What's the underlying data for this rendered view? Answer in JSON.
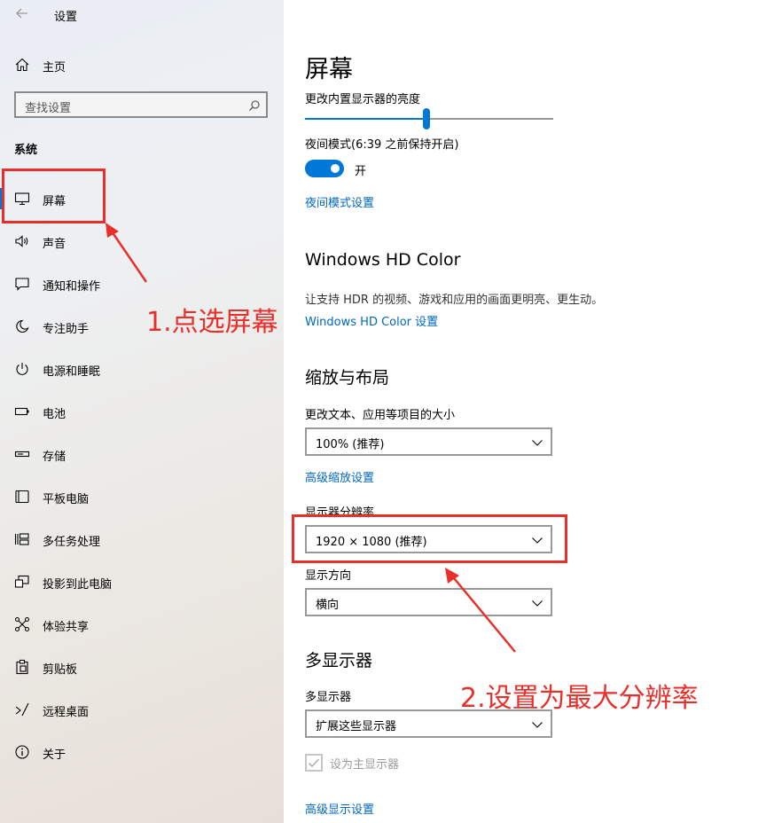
{
  "app": {
    "title": "设置"
  },
  "sidebar": {
    "home_label": "主页",
    "search_placeholder": "查找设置",
    "section_label": "系统",
    "items": [
      {
        "label": "屏幕",
        "icon": "monitor-icon"
      },
      {
        "label": "声音",
        "icon": "speaker-icon"
      },
      {
        "label": "通知和操作",
        "icon": "message-icon"
      },
      {
        "label": "专注助手",
        "icon": "moon-icon"
      },
      {
        "label": "电源和睡眠",
        "icon": "power-icon"
      },
      {
        "label": "电池",
        "icon": "battery-icon"
      },
      {
        "label": "存储",
        "icon": "storage-icon"
      },
      {
        "label": "平板电脑",
        "icon": "tablet-icon"
      },
      {
        "label": "多任务处理",
        "icon": "multitask-icon"
      },
      {
        "label": "投影到此电脑",
        "icon": "project-icon"
      },
      {
        "label": "体验共享",
        "icon": "share-icon"
      },
      {
        "label": "剪贴板",
        "icon": "clipboard-icon"
      },
      {
        "label": "远程桌面",
        "icon": "remote-desktop-icon"
      },
      {
        "label": "关于",
        "icon": "info-icon"
      }
    ]
  },
  "main": {
    "title": "屏幕",
    "brightness_label": "更改内置显示器的亮度",
    "brightness_level": 0.49,
    "night_mode_label": "夜间模式(6:39 之前保持开启)",
    "night_toggle_label": "开",
    "night_toggle_on": true,
    "night_settings_link": "夜间模式设置",
    "hdr_heading": "Windows HD Color",
    "hdr_desc": "让支持 HDR 的视频、游戏和应用的画面更明亮、更生动。",
    "hdr_link": "Windows HD Color 设置",
    "scale_heading": "缩放与布局",
    "scale_label": "更改文本、应用等项目的大小",
    "scale_value": "100% (推荐)",
    "adv_scale_link": "高级缩放设置",
    "resolution_label": "显示器分辨率",
    "resolution_value": "1920 × 1080 (推荐)",
    "orientation_label": "显示方向",
    "orientation_value": "横向",
    "multi_heading": "多显示器",
    "multi_label": "多显示器",
    "multi_value": "扩展这些显示器",
    "primary_checkbox_label": "设为主显示器",
    "primary_checked": true,
    "adv_display_link": "高级显示设置"
  },
  "annotations": {
    "step1": "1.点选屏幕",
    "step2": "2.设置为最大分辨率",
    "color": "#e8302b"
  },
  "colors": {
    "accent": "#0078d7",
    "link": "#0067c0"
  }
}
